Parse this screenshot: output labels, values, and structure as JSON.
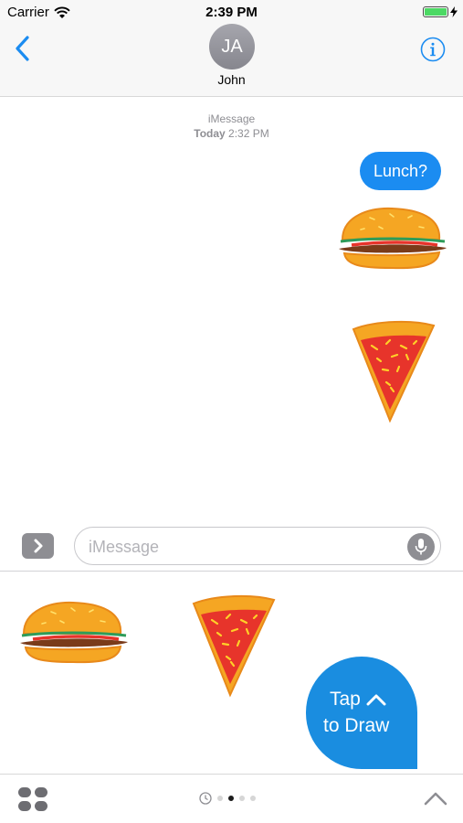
{
  "status_bar": {
    "carrier": "Carrier",
    "time": "2:39 PM",
    "battery_color": "#4cd964"
  },
  "header": {
    "back_icon": "chevron-left-icon",
    "avatar_initials": "JA",
    "contact_name": "John",
    "info_icon": "info-icon",
    "accent": "#1b8cf1"
  },
  "conversation": {
    "service": "iMessage",
    "date_day": "Today",
    "date_time": "2:32 PM",
    "messages": [
      {
        "type": "text",
        "text": "Lunch?",
        "outgoing": true
      },
      {
        "type": "sticker",
        "sticker": "burger-sticker",
        "outgoing": true
      },
      {
        "type": "sticker",
        "sticker": "pizza-sticker",
        "outgoing": true
      }
    ]
  },
  "compose": {
    "apps_icon": "chevron-right-icon",
    "placeholder": "iMessage",
    "value": "",
    "mic_icon": "microphone-icon"
  },
  "drawer": {
    "stickers": [
      "burger-sticker",
      "pizza-sticker"
    ],
    "tap_to_draw_line1": "Tap",
    "tap_to_draw_line2": "to Draw",
    "tap_color": "#1a8de0"
  },
  "bottom_bar": {
    "apps_grid_icon": "app-grid-icon",
    "pages": [
      "recents",
      "page-1",
      "page-2",
      "page-3"
    ],
    "active_page": 1,
    "expand_icon": "chevron-up-icon"
  }
}
